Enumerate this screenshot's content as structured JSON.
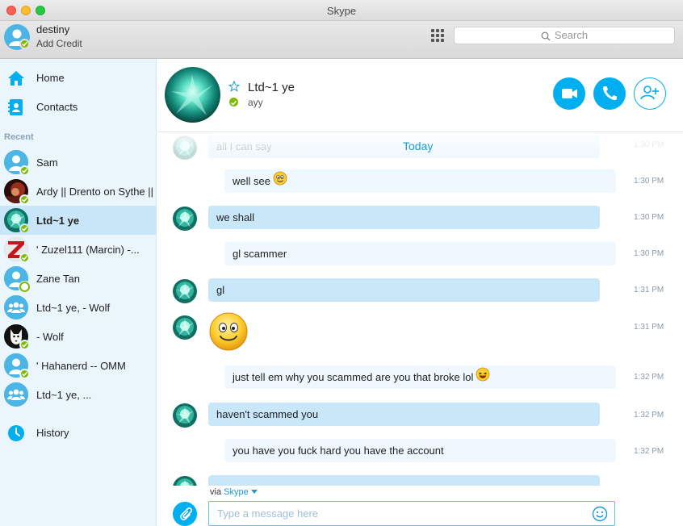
{
  "window": {
    "title": "Skype"
  },
  "profile": {
    "name": "destiny",
    "credit_label": "Add Credit"
  },
  "search": {
    "placeholder": "Search"
  },
  "nav": {
    "home": "Home",
    "contacts": "Contacts",
    "recent_heading": "Recent",
    "history": "History"
  },
  "contacts": [
    {
      "name": "Sam",
      "status": "online",
      "avatar": "default"
    },
    {
      "name": "Ardy || Drento on Sythe ||",
      "status": "online",
      "avatar": "photo-red"
    },
    {
      "name": "Ltd~1 ye",
      "status": "online",
      "avatar": "crystal",
      "selected": true
    },
    {
      "name": "' Zuzel111 (Marcin) -...",
      "status": "online",
      "avatar": "letter-z"
    },
    {
      "name": "Zane Tan",
      "status": "offline",
      "avatar": "default"
    },
    {
      "name": "Ltd~1 ye, - Wolf",
      "status": "group",
      "avatar": "group"
    },
    {
      "name": "- Wolf",
      "status": "online",
      "avatar": "wolf"
    },
    {
      "name": "' Hahanerd -- OMM",
      "status": "online",
      "avatar": "default"
    },
    {
      "name": "Ltd~1 ye, ...",
      "status": "group",
      "avatar": "group"
    }
  ],
  "conversation": {
    "name": "Ltd~1 ye",
    "mood": "ayy",
    "today_label": "Today",
    "messages": [
      {
        "dir": "in",
        "text": "all I can say",
        "time": "1:30 PM",
        "faded": true
      },
      {
        "dir": "out",
        "text": "well see",
        "time": "1:30 PM",
        "emoji": "smile"
      },
      {
        "dir": "in",
        "text": "we shall",
        "time": "1:30 PM"
      },
      {
        "dir": "out",
        "text": "gl scammer",
        "time": "1:30 PM"
      },
      {
        "dir": "in",
        "text": "gl",
        "time": "1:31 PM"
      },
      {
        "dir": "in",
        "text": "",
        "time": "1:31 PM",
        "emoji": "big-smile"
      },
      {
        "dir": "out",
        "text": "just tell em why you scammed are you that broke lol",
        "time": "1:32 PM",
        "emoji": "laugh"
      },
      {
        "dir": "in",
        "text": "haven't scammed you",
        "time": "1:32 PM"
      },
      {
        "dir": "out",
        "text": "you have you fuck hard you have the account",
        "time": "1:32 PM"
      }
    ]
  },
  "composer": {
    "via_prefix": "via",
    "via_brand": "Skype",
    "placeholder": "Type a message here"
  },
  "colors": {
    "accent": "#00aff0",
    "online": "#7fba00",
    "sidebar_bg": "#eaf5fc",
    "selected_bg": "#c8e6f7",
    "incoming_bubble": "#c8e8fa",
    "outgoing_bubble": "#eef8fe"
  }
}
